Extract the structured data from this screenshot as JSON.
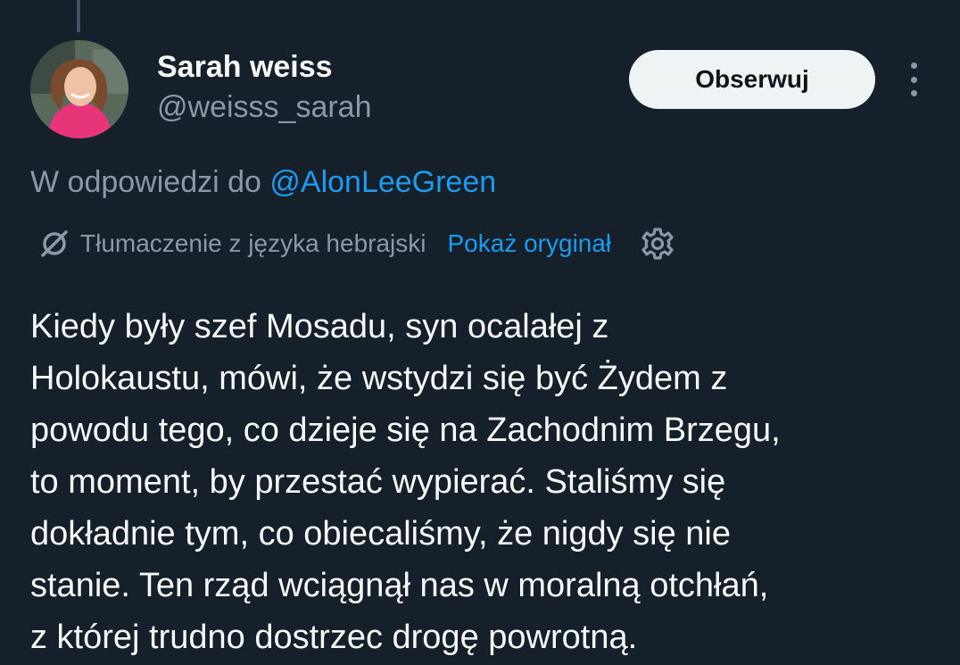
{
  "colors": {
    "background": "#15202b",
    "primary_text": "#f7f9f9",
    "secondary_text": "#8b98a5",
    "link": "#1d9bf0",
    "follow_button_bg": "#eff3f4",
    "follow_button_text": "#0f1419"
  },
  "author": {
    "name": "Sarah weiss",
    "handle": "@weisss_sarah",
    "avatar_icon": "profile-photo"
  },
  "follow_button": {
    "label": "Obserwuj"
  },
  "more_menu": {
    "icon": "more-vertical-icon"
  },
  "reply": {
    "prefix": "W odpowiedzi do ",
    "mention": "@AlonLeeGreen"
  },
  "translation": {
    "icon": "translate-icon",
    "label": "Tłumaczenie z języka hebrajski",
    "show_original": "Pokaż oryginał",
    "settings_icon": "gear-icon"
  },
  "tweet": {
    "lines": [
      "Kiedy były szef Mosadu, syn ocalałej z",
      "Holokaustu, mówi, że wstydzi się być Żydem z",
      "powodu tego, co dzieje się na Zachodnim Brzegu,",
      "to moment, by przestać wypierać. Staliśmy się",
      "dokładnie tym, co obiecaliśmy, że nigdy się nie",
      "stanie. Ten rząd wciągnął nas w moralną otchłań,",
      "z której trudno dostrzec drogę powrotną."
    ]
  }
}
